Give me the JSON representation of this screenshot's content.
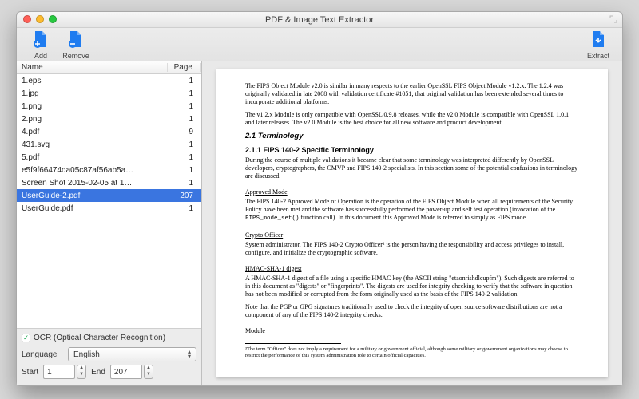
{
  "window": {
    "title": "PDF & Image Text Extractor"
  },
  "toolbar": {
    "add_label": "Add",
    "remove_label": "Remove",
    "extract_label": "Extract"
  },
  "list": {
    "header_name": "Name",
    "header_page": "Page",
    "rows": [
      {
        "name": "1.eps",
        "page": "1"
      },
      {
        "name": "1.jpg",
        "page": "1"
      },
      {
        "name": "1.png",
        "page": "1"
      },
      {
        "name": "2.png",
        "page": "1"
      },
      {
        "name": "4.pdf",
        "page": "9"
      },
      {
        "name": "431.svg",
        "page": "1"
      },
      {
        "name": "5.pdf",
        "page": "1"
      },
      {
        "name": "e5f9f66474da05c87af56ab5a…",
        "page": "1"
      },
      {
        "name": "Screen Shot 2015-02-05 at 1…",
        "page": "1"
      },
      {
        "name": "UserGuide-2.pdf",
        "page": "207"
      },
      {
        "name": "UserGuide.pdf",
        "page": "1"
      }
    ],
    "selected_index": 9
  },
  "controls": {
    "ocr_checked": true,
    "ocr_label": "OCR (Optical Character Recognition)",
    "language_label": "Language",
    "language_value": "English",
    "start_label": "Start",
    "start_value": "1",
    "end_label": "End",
    "end_value": "207"
  },
  "doc": {
    "p1": "The FIPS Object Module v2.0 is similar in many respects to the earlier OpenSSL FIPS Object Module v1.2.x.  The 1.2.4 was originally validated in late 2008 with validation certificate #1051; that original validation has been extended several times to incorporate additional platforms.",
    "p2": "The v1.2.x Module is only compatible with OpenSSL 0.9.8 releases, while the v2.0 Module is compatible with OpenSSL 1.0.1 and later releases. The v2.0 Module is the best choice for all new software and product development.",
    "h2": "2.1   Terminology",
    "h3": "2.1.1  FIPS 140-2 Specific Terminology",
    "p3": "During the course of multiple validations it became clear that some terminology was interpreted differently by OpenSSL developers, cryptographers, the CMVP and FIPS 140-2 specialists.  In this section some of the potential confusions in terminology are discussed.",
    "u1": "Approved Mode",
    "p4a": "The FIPS 140-2 Approved Mode of Operation is the operation of the FIPS Object Module when all requirements of the Security Policy have been met and the software has successfully performed the power-up and self test operation (invocation of the ",
    "p4code": "FIPS_mode_set()",
    "p4b": " function call).  In this document this Approved Mode is referred to simply as FIPS mode.",
    "u2": "Crypto Officer",
    "p5": "System administrator.  The FIPS 140-2 Crypto Officer³ is the person having the responsibility and access privileges to install, configure, and initialize the cryptographic software.",
    "u3": "HMAC-SHA-1 digest",
    "p6": "A HMAC-SHA-1 digest of a file using a specific HMAC key (the ASCII string \"etaonrishdlcupfm\"). Such digests are referred to in this document as \"digests\" or \"fingerprints\". The digests are used for integrity checking to verify that the software in question has not been modified or corrupted from the form originally used as the basis of the FIPS 140-2 validation.",
    "p7": "Note that the PGP or GPG signatures traditionally used to check the integrity of open source software distributions are not a component of any of the FIPS 140-2 integrity checks.",
    "u4": "Module",
    "fn": "³The term \"Officer\" does not imply a requirement for a military or government official, although some military or government organizations may choose to restrict the performance of this system administration role to certain official capacities."
  }
}
